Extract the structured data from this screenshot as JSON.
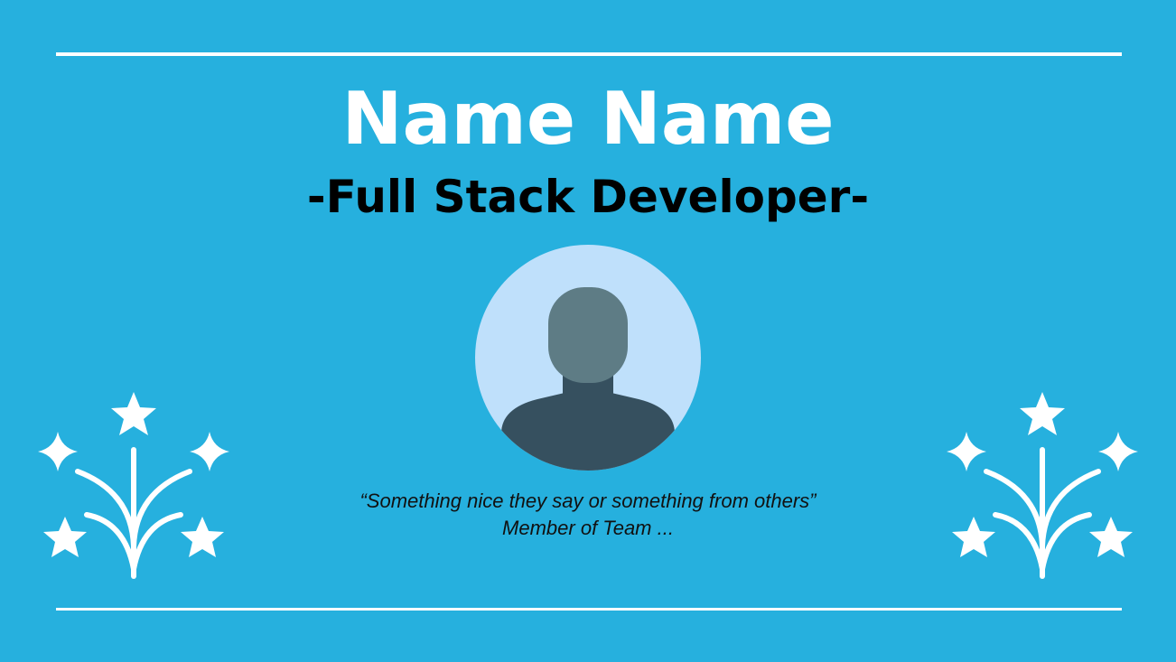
{
  "slide": {
    "background_color": "#26b0de",
    "accent_color": "#ffffff",
    "name": "Name Name",
    "role": "-Full Stack Developer-",
    "avatar_icon": "person-avatar-icon",
    "quote": "“Something nice they say or something from others”",
    "attribution": "Member of Team ...",
    "decorations": [
      "fireworks-icon",
      "fireworks-icon"
    ]
  }
}
